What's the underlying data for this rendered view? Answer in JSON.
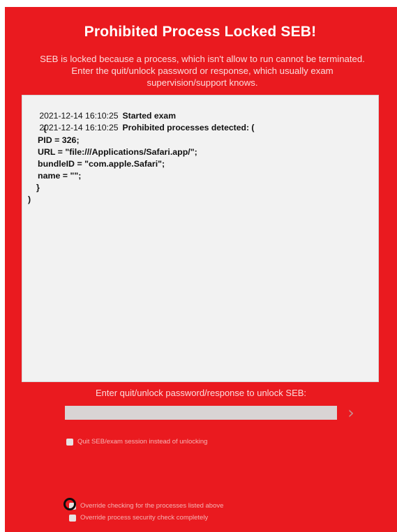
{
  "dialog": {
    "title": "Prohibited Process Locked SEB!",
    "description": "SEB is locked because a process, which isn't allow to run cannot be terminated. Enter the quit/unlock password or response, which usually exam supervision/support knows."
  },
  "log": {
    "entries": [
      {
        "timestamp": "2021-12-14 16:10:25",
        "message": "Started exam"
      },
      {
        "timestamp": "2021-12-14 16:10:25",
        "message": "Prohibited processes detected: ("
      }
    ],
    "details": [
      "{",
      "PID = 326;",
      "URL = \"file:///Applications/Safari.app/\";",
      "bundleID = \"com.apple.Safari\";",
      "name = \"\";",
      "}",
      ")"
    ]
  },
  "unlock": {
    "prompt": "Enter quit/unlock password/response to unlock SEB:",
    "password_value": "",
    "submit_icon": "chevron-right-icon"
  },
  "options": {
    "quit_instead": {
      "label": "Quit SEB/exam session instead of unlocking",
      "checked": false
    },
    "override_listed": {
      "label": "Override checking for the processes listed above",
      "checked": false
    },
    "override_security": {
      "label": "Override process security check completely",
      "checked": false
    }
  },
  "colors": {
    "background": "#ea1a1f",
    "log_background": "#f2f2f2"
  }
}
